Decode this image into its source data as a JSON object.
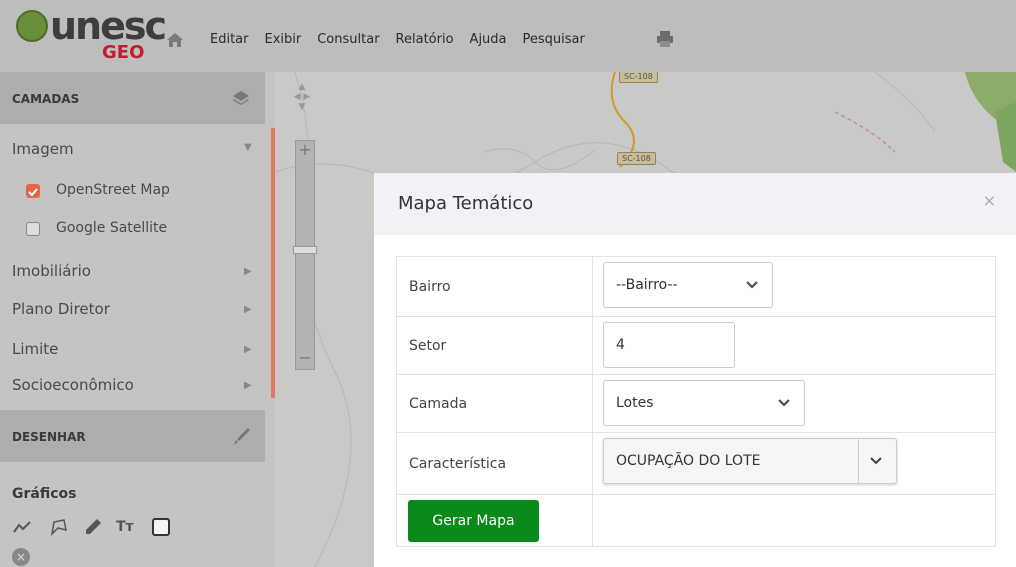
{
  "header": {
    "logo_word": "unesc",
    "logo_sub": "GEO",
    "menu": [
      "Editar",
      "Exibir",
      "Consultar",
      "Relatório",
      "Ajuda",
      "Pesquisar"
    ]
  },
  "sidebar": {
    "camadas_title": "CAMADAS",
    "layers": [
      {
        "label": "Imagem"
      },
      {
        "label": "Imobiliário"
      },
      {
        "label": "Plano Diretor"
      },
      {
        "label": "Limite"
      },
      {
        "label": "Socioeconômico"
      }
    ],
    "base_maps": [
      {
        "label": "OpenStreet Map",
        "checked": true
      },
      {
        "label": "Google Satellite",
        "checked": false
      }
    ],
    "desenhar_title": "DESENHAR",
    "graficos_title": "Gráficos"
  },
  "map": {
    "roads": [
      "SC-108",
      "SC-108"
    ]
  },
  "modal": {
    "title": "Mapa Temático",
    "close": "×",
    "fields": {
      "bairro_label": "Bairro",
      "bairro_value": "--Bairro--",
      "setor_label": "Setor",
      "setor_value": "4",
      "camada_label": "Camada",
      "camada_value": "Lotes",
      "caracteristica_label": "Característica",
      "caracteristica_value": "OCUPAÇÃO DO LOTE"
    },
    "submit_label": "Gerar Mapa"
  },
  "colors": {
    "accent_checkbox": "#e2664d",
    "button_green": "#0a8a1a",
    "logo_red": "#c01e2a"
  }
}
